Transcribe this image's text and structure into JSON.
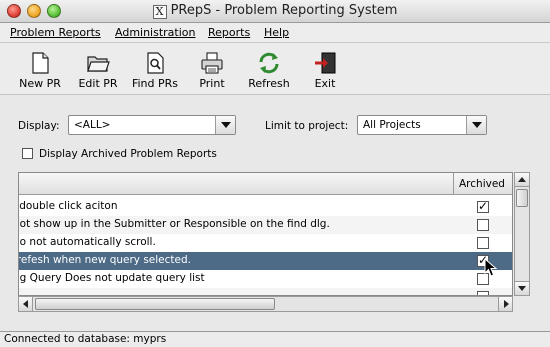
{
  "window": {
    "x_glyph": "X",
    "title": "PRepS - Problem Reporting System"
  },
  "menubar": {
    "items": [
      {
        "label": "Problem Reports"
      },
      {
        "label": "Administration"
      },
      {
        "label": "Reports"
      },
      {
        "label": "Help"
      }
    ]
  },
  "toolbar": {
    "buttons": [
      {
        "label": "New PR",
        "icon": "new-document-icon"
      },
      {
        "label": "Edit PR",
        "icon": "folder-open-icon"
      },
      {
        "label": "Find PRs",
        "icon": "find-document-icon"
      },
      {
        "label": "Print",
        "icon": "printer-icon"
      },
      {
        "label": "Refresh",
        "icon": "refresh-arrows-icon"
      },
      {
        "label": "Exit",
        "icon": "exit-door-icon"
      }
    ]
  },
  "filters": {
    "display_label": "Display:",
    "display_value": "<ALL>",
    "project_label": "Limit to project:",
    "project_value": "All Projects",
    "archived_checkbox_label": "Display Archived Problem Reports",
    "archived_checkbox_checked": false
  },
  "table": {
    "archived_header": "Archived",
    "rows": [
      {
        "text": "l double click aciton",
        "archived": true,
        "selected": false
      },
      {
        "text": "not show up in the Submitter or Responsible on the find dlg.",
        "archived": false,
        "selected": false
      },
      {
        "text": "do not automatically scroll.",
        "archived": false,
        "selected": false
      },
      {
        "text": "-refesh when new query selected.",
        "archived": true,
        "selected": true
      },
      {
        "text": "ng Query Does not update query list",
        "archived": false,
        "selected": false
      }
    ],
    "check_glyph": "✓"
  },
  "status": {
    "text": "Connected to database: myprs"
  },
  "colors": {
    "selection": "#4d6b86"
  }
}
